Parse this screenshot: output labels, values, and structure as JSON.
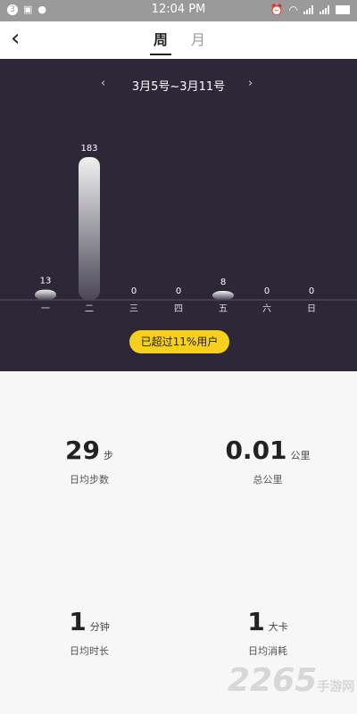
{
  "status_bar": {
    "time": "12:04 PM",
    "notif_count": "3"
  },
  "header": {
    "back_icon": "chevron-left-icon",
    "tab_week": "周",
    "tab_month": "月"
  },
  "range": {
    "label": "3月5号~3月11号",
    "prev": "‹",
    "next": "›"
  },
  "chart_data": {
    "type": "bar",
    "categories": [
      "一",
      "二",
      "三",
      "四",
      "五",
      "六",
      "日"
    ],
    "values": [
      13,
      183,
      0,
      0,
      8,
      0,
      0
    ],
    "ylim": [
      0,
      183
    ]
  },
  "summary_pill": "已超过11%用户",
  "stats": {
    "steps": {
      "value": "29",
      "unit": "步",
      "label": "日均步数"
    },
    "distance": {
      "value": "0.01",
      "unit": "公里",
      "label": "总公里"
    },
    "duration": {
      "value": "1",
      "unit": "分钟",
      "label": "日均时长"
    },
    "calories": {
      "value": "1",
      "unit": "大卡",
      "label": "日均消耗"
    }
  },
  "watermark": {
    "main": "2265",
    "sub": "手游网"
  },
  "colors": {
    "dark_bg": "#2c2837",
    "accent": "#f7cf1d"
  }
}
